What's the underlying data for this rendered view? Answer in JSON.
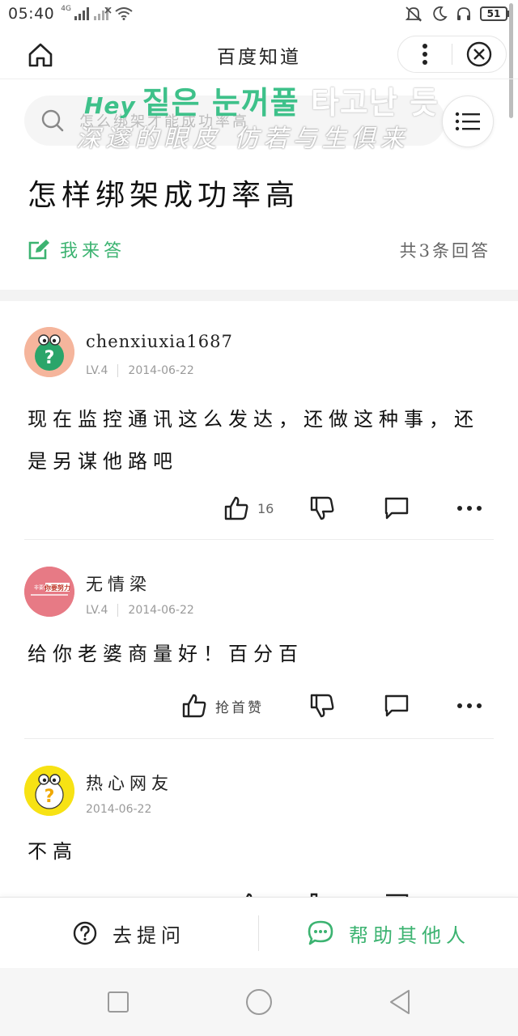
{
  "status": {
    "time": "05:40",
    "network": "4G",
    "battery": "51"
  },
  "nav": {
    "title": "百度知道"
  },
  "search": {
    "placeholder": "怎么绑架才能成功率高"
  },
  "overlay": {
    "hey": "Hey",
    "korean_green": "짙은 눈꺼풀",
    "korean_white": "타고난 듯",
    "chinese_line": "深邃的眼皮  仿若与生俱来"
  },
  "question": {
    "title": "怎样绑架成功率高",
    "answer_label": "我来答",
    "answer_count": "共3条回答"
  },
  "answers": [
    {
      "user": "chenxiuxia1687",
      "level": "LV.4",
      "date": "2014-06-22",
      "text": "现在监控通讯这么发达，还做这种事，还是另谋他路吧",
      "likes": "16"
    },
    {
      "user": "无情梁",
      "level": "LV.4",
      "date": "2014-06-22",
      "avatar_text_top": "非要的",
      "avatar_text_mid": "你要努力",
      "text": "给你老婆商量好！百分百",
      "likes_label": "抢首赞"
    },
    {
      "user": "热心网友",
      "date": "2014-06-22",
      "text": "不高"
    }
  ],
  "bottom": {
    "ask_label": "去提问",
    "help_label": "帮助其他人"
  },
  "colors": {
    "accent_green": "#3cb371",
    "text_dark": "#111111",
    "meta_gray": "#9a9a9a"
  }
}
